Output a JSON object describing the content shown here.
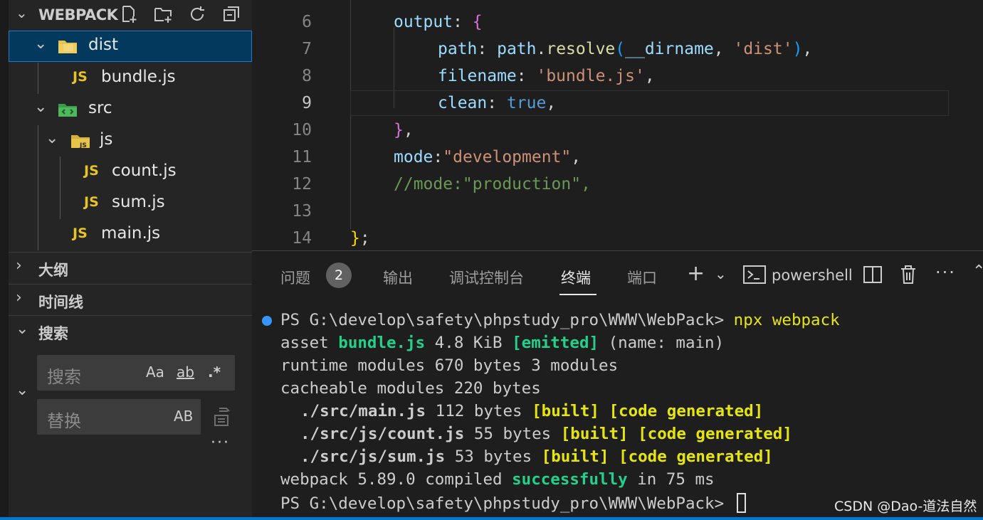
{
  "explorer": {
    "title": "WEBPACK",
    "tree": [
      {
        "name": "dist",
        "kind": "folder",
        "expanded": true,
        "selected": true
      },
      {
        "name": "bundle.js",
        "kind": "js"
      },
      {
        "name": "src",
        "kind": "folder",
        "expanded": true
      },
      {
        "name": "js",
        "kind": "folder",
        "expanded": true
      },
      {
        "name": "count.js",
        "kind": "js"
      },
      {
        "name": "sum.js",
        "kind": "js"
      },
      {
        "name": "main.js",
        "kind": "js"
      }
    ],
    "js_badge": "JS",
    "sections": {
      "outline": "大纲",
      "timeline": "时间线",
      "search": "搜索"
    },
    "search": {
      "placeholder": "搜索",
      "match_case": "Aa",
      "whole_word": "ab",
      "regex": ".*",
      "replace_placeholder": "替换",
      "preserve_case": "AB",
      "more": "···"
    }
  },
  "editor": {
    "active_line": 9,
    "lines": [
      {
        "n": "6"
      },
      {
        "n": "7"
      },
      {
        "n": "8"
      },
      {
        "n": "9"
      },
      {
        "n": "10"
      },
      {
        "n": "11"
      },
      {
        "n": "12"
      },
      {
        "n": "13"
      },
      {
        "n": "14"
      }
    ],
    "tokens": {
      "output": "output",
      "path": "path",
      "path_obj": "path",
      "resolve": "resolve",
      "dirname": "__dirname",
      "dist_str": "'dist'",
      "filename": "filename",
      "bundle_str": "'bundle.js'",
      "clean": "clean",
      "true_val": "true",
      "mode": "mode",
      "dev_str": "\"development\"",
      "comment": "//mode:\"production\","
    }
  },
  "panel": {
    "tabs": [
      "问题",
      "输出",
      "调试控制台",
      "终端",
      "端口"
    ],
    "active_tab": "终端",
    "problems_count": "2",
    "shell": "powershell",
    "terminal": {
      "prompt": "PS G:\\develop\\safety\\phpstudy_pro\\WWW\\WebPack>",
      "command": "npx webpack",
      "asset": {
        "label": "asset",
        "file": "bundle.js",
        "size": "4.8 KiB",
        "status": "[emitted]",
        "name": "(name: main)"
      },
      "runtime": "runtime modules 670 bytes 3 modules",
      "cacheable": "cacheable modules 220 bytes",
      "modules": [
        {
          "path": "./src/main.js",
          "size": "112 bytes"
        },
        {
          "path": "./src/js/count.js",
          "size": "55 bytes"
        },
        {
          "path": "./src/js/sum.js",
          "size": "53 bytes"
        }
      ],
      "built": "[built]",
      "generated": "[code generated]",
      "compiled_pre": "webpack 5.89.0 compiled",
      "compiled_ok": "successfully",
      "compiled_post": "in 75 ms"
    }
  },
  "watermark": "CSDN @Dao-道法自然",
  "colors": {
    "accent": "#007acc",
    "selection": "#04395e",
    "terminal_yellow": "#e5e510",
    "terminal_green": "#23d18b",
    "js_icon": "#e8c326"
  }
}
